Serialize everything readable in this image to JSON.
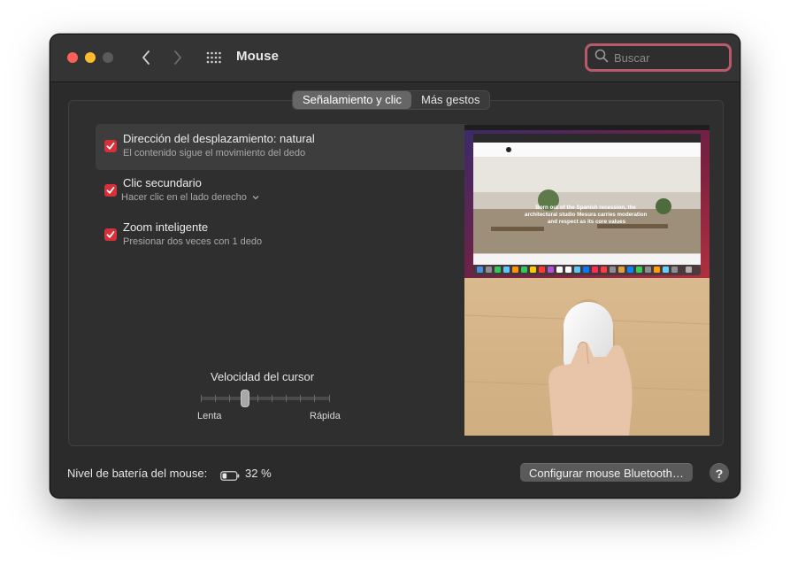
{
  "window": {
    "title": "Mouse"
  },
  "search": {
    "placeholder": "Buscar"
  },
  "tabs": [
    {
      "label": "Señalamiento y clic",
      "active": true
    },
    {
      "label": "Más gestos",
      "active": false
    }
  ],
  "options": [
    {
      "title": "Dirección del desplazamiento: natural",
      "subtitle": "El contenido sigue el movimiento del dedo",
      "checked": true
    },
    {
      "title": "Clic secundario",
      "subtitle": "Hacer clic en el lado derecho",
      "checked": true,
      "dropdown": true
    },
    {
      "title": "Zoom inteligente",
      "subtitle": "Presionar dos veces con 1 dedo",
      "checked": true
    }
  ],
  "cursor_speed": {
    "label": "Velocidad del cursor",
    "min_label": "Lenta",
    "max_label": "Rápida",
    "level": 0.33
  },
  "preview": {
    "hero_text": "Born out of the Spanish recession, the architectural studio Mesura carries moderation and respect as its core values"
  },
  "footer": {
    "battery_label": "Nivel de batería del mouse:",
    "battery_value": "32 %",
    "battery_level": 0.32,
    "config_button": "Configurar mouse Bluetooth…",
    "help_button": "?"
  },
  "colors": {
    "checkbox": "#d6303a",
    "search_focus": "#b85a6a",
    "close": "#fe5f57",
    "minimize": "#febc2e"
  },
  "icons": [
    "back-chevron-icon",
    "forward-chevron-icon",
    "grid-icon",
    "search-icon",
    "checkmark-icon",
    "battery-icon"
  ]
}
